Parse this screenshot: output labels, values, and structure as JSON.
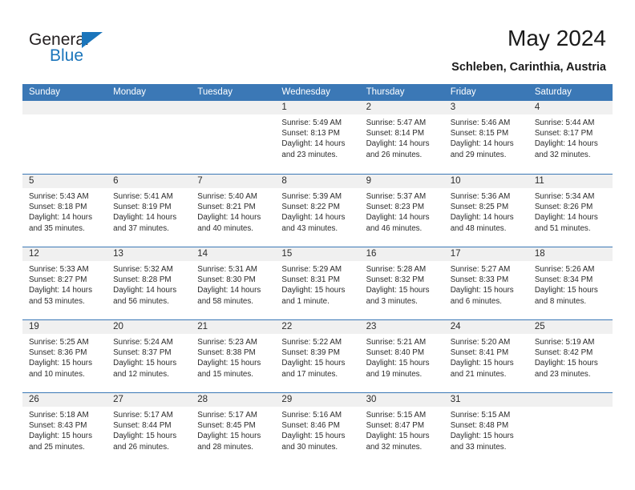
{
  "brand": {
    "name_primary": "General",
    "name_secondary": "Blue"
  },
  "header": {
    "title": "May 2024",
    "subtitle": "Schleben, Carinthia, Austria"
  },
  "colors": {
    "header_band": "#3b78b6",
    "brand_blue": "#1b75bb",
    "date_band": "#f0f0f0",
    "text": "#2b2b2b"
  },
  "weekday_headers": [
    "Sunday",
    "Monday",
    "Tuesday",
    "Wednesday",
    "Thursday",
    "Friday",
    "Saturday"
  ],
  "weeks": [
    [
      {
        "date": "",
        "sunrise": "",
        "sunset": "",
        "daylight_line1": "",
        "daylight_line2": ""
      },
      {
        "date": "",
        "sunrise": "",
        "sunset": "",
        "daylight_line1": "",
        "daylight_line2": ""
      },
      {
        "date": "",
        "sunrise": "",
        "sunset": "",
        "daylight_line1": "",
        "daylight_line2": ""
      },
      {
        "date": "1",
        "sunrise": "Sunrise: 5:49 AM",
        "sunset": "Sunset: 8:13 PM",
        "daylight_line1": "Daylight: 14 hours",
        "daylight_line2": "and 23 minutes."
      },
      {
        "date": "2",
        "sunrise": "Sunrise: 5:47 AM",
        "sunset": "Sunset: 8:14 PM",
        "daylight_line1": "Daylight: 14 hours",
        "daylight_line2": "and 26 minutes."
      },
      {
        "date": "3",
        "sunrise": "Sunrise: 5:46 AM",
        "sunset": "Sunset: 8:15 PM",
        "daylight_line1": "Daylight: 14 hours",
        "daylight_line2": "and 29 minutes."
      },
      {
        "date": "4",
        "sunrise": "Sunrise: 5:44 AM",
        "sunset": "Sunset: 8:17 PM",
        "daylight_line1": "Daylight: 14 hours",
        "daylight_line2": "and 32 minutes."
      }
    ],
    [
      {
        "date": "5",
        "sunrise": "Sunrise: 5:43 AM",
        "sunset": "Sunset: 8:18 PM",
        "daylight_line1": "Daylight: 14 hours",
        "daylight_line2": "and 35 minutes."
      },
      {
        "date": "6",
        "sunrise": "Sunrise: 5:41 AM",
        "sunset": "Sunset: 8:19 PM",
        "daylight_line1": "Daylight: 14 hours",
        "daylight_line2": "and 37 minutes."
      },
      {
        "date": "7",
        "sunrise": "Sunrise: 5:40 AM",
        "sunset": "Sunset: 8:21 PM",
        "daylight_line1": "Daylight: 14 hours",
        "daylight_line2": "and 40 minutes."
      },
      {
        "date": "8",
        "sunrise": "Sunrise: 5:39 AM",
        "sunset": "Sunset: 8:22 PM",
        "daylight_line1": "Daylight: 14 hours",
        "daylight_line2": "and 43 minutes."
      },
      {
        "date": "9",
        "sunrise": "Sunrise: 5:37 AM",
        "sunset": "Sunset: 8:23 PM",
        "daylight_line1": "Daylight: 14 hours",
        "daylight_line2": "and 46 minutes."
      },
      {
        "date": "10",
        "sunrise": "Sunrise: 5:36 AM",
        "sunset": "Sunset: 8:25 PM",
        "daylight_line1": "Daylight: 14 hours",
        "daylight_line2": "and 48 minutes."
      },
      {
        "date": "11",
        "sunrise": "Sunrise: 5:34 AM",
        "sunset": "Sunset: 8:26 PM",
        "daylight_line1": "Daylight: 14 hours",
        "daylight_line2": "and 51 minutes."
      }
    ],
    [
      {
        "date": "12",
        "sunrise": "Sunrise: 5:33 AM",
        "sunset": "Sunset: 8:27 PM",
        "daylight_line1": "Daylight: 14 hours",
        "daylight_line2": "and 53 minutes."
      },
      {
        "date": "13",
        "sunrise": "Sunrise: 5:32 AM",
        "sunset": "Sunset: 8:28 PM",
        "daylight_line1": "Daylight: 14 hours",
        "daylight_line2": "and 56 minutes."
      },
      {
        "date": "14",
        "sunrise": "Sunrise: 5:31 AM",
        "sunset": "Sunset: 8:30 PM",
        "daylight_line1": "Daylight: 14 hours",
        "daylight_line2": "and 58 minutes."
      },
      {
        "date": "15",
        "sunrise": "Sunrise: 5:29 AM",
        "sunset": "Sunset: 8:31 PM",
        "daylight_line1": "Daylight: 15 hours",
        "daylight_line2": "and 1 minute."
      },
      {
        "date": "16",
        "sunrise": "Sunrise: 5:28 AM",
        "sunset": "Sunset: 8:32 PM",
        "daylight_line1": "Daylight: 15 hours",
        "daylight_line2": "and 3 minutes."
      },
      {
        "date": "17",
        "sunrise": "Sunrise: 5:27 AM",
        "sunset": "Sunset: 8:33 PM",
        "daylight_line1": "Daylight: 15 hours",
        "daylight_line2": "and 6 minutes."
      },
      {
        "date": "18",
        "sunrise": "Sunrise: 5:26 AM",
        "sunset": "Sunset: 8:34 PM",
        "daylight_line1": "Daylight: 15 hours",
        "daylight_line2": "and 8 minutes."
      }
    ],
    [
      {
        "date": "19",
        "sunrise": "Sunrise: 5:25 AM",
        "sunset": "Sunset: 8:36 PM",
        "daylight_line1": "Daylight: 15 hours",
        "daylight_line2": "and 10 minutes."
      },
      {
        "date": "20",
        "sunrise": "Sunrise: 5:24 AM",
        "sunset": "Sunset: 8:37 PM",
        "daylight_line1": "Daylight: 15 hours",
        "daylight_line2": "and 12 minutes."
      },
      {
        "date": "21",
        "sunrise": "Sunrise: 5:23 AM",
        "sunset": "Sunset: 8:38 PM",
        "daylight_line1": "Daylight: 15 hours",
        "daylight_line2": "and 15 minutes."
      },
      {
        "date": "22",
        "sunrise": "Sunrise: 5:22 AM",
        "sunset": "Sunset: 8:39 PM",
        "daylight_line1": "Daylight: 15 hours",
        "daylight_line2": "and 17 minutes."
      },
      {
        "date": "23",
        "sunrise": "Sunrise: 5:21 AM",
        "sunset": "Sunset: 8:40 PM",
        "daylight_line1": "Daylight: 15 hours",
        "daylight_line2": "and 19 minutes."
      },
      {
        "date": "24",
        "sunrise": "Sunrise: 5:20 AM",
        "sunset": "Sunset: 8:41 PM",
        "daylight_line1": "Daylight: 15 hours",
        "daylight_line2": "and 21 minutes."
      },
      {
        "date": "25",
        "sunrise": "Sunrise: 5:19 AM",
        "sunset": "Sunset: 8:42 PM",
        "daylight_line1": "Daylight: 15 hours",
        "daylight_line2": "and 23 minutes."
      }
    ],
    [
      {
        "date": "26",
        "sunrise": "Sunrise: 5:18 AM",
        "sunset": "Sunset: 8:43 PM",
        "daylight_line1": "Daylight: 15 hours",
        "daylight_line2": "and 25 minutes."
      },
      {
        "date": "27",
        "sunrise": "Sunrise: 5:17 AM",
        "sunset": "Sunset: 8:44 PM",
        "daylight_line1": "Daylight: 15 hours",
        "daylight_line2": "and 26 minutes."
      },
      {
        "date": "28",
        "sunrise": "Sunrise: 5:17 AM",
        "sunset": "Sunset: 8:45 PM",
        "daylight_line1": "Daylight: 15 hours",
        "daylight_line2": "and 28 minutes."
      },
      {
        "date": "29",
        "sunrise": "Sunrise: 5:16 AM",
        "sunset": "Sunset: 8:46 PM",
        "daylight_line1": "Daylight: 15 hours",
        "daylight_line2": "and 30 minutes."
      },
      {
        "date": "30",
        "sunrise": "Sunrise: 5:15 AM",
        "sunset": "Sunset: 8:47 PM",
        "daylight_line1": "Daylight: 15 hours",
        "daylight_line2": "and 32 minutes."
      },
      {
        "date": "31",
        "sunrise": "Sunrise: 5:15 AM",
        "sunset": "Sunset: 8:48 PM",
        "daylight_line1": "Daylight: 15 hours",
        "daylight_line2": "and 33 minutes."
      },
      {
        "date": "",
        "sunrise": "",
        "sunset": "",
        "daylight_line1": "",
        "daylight_line2": ""
      }
    ]
  ]
}
